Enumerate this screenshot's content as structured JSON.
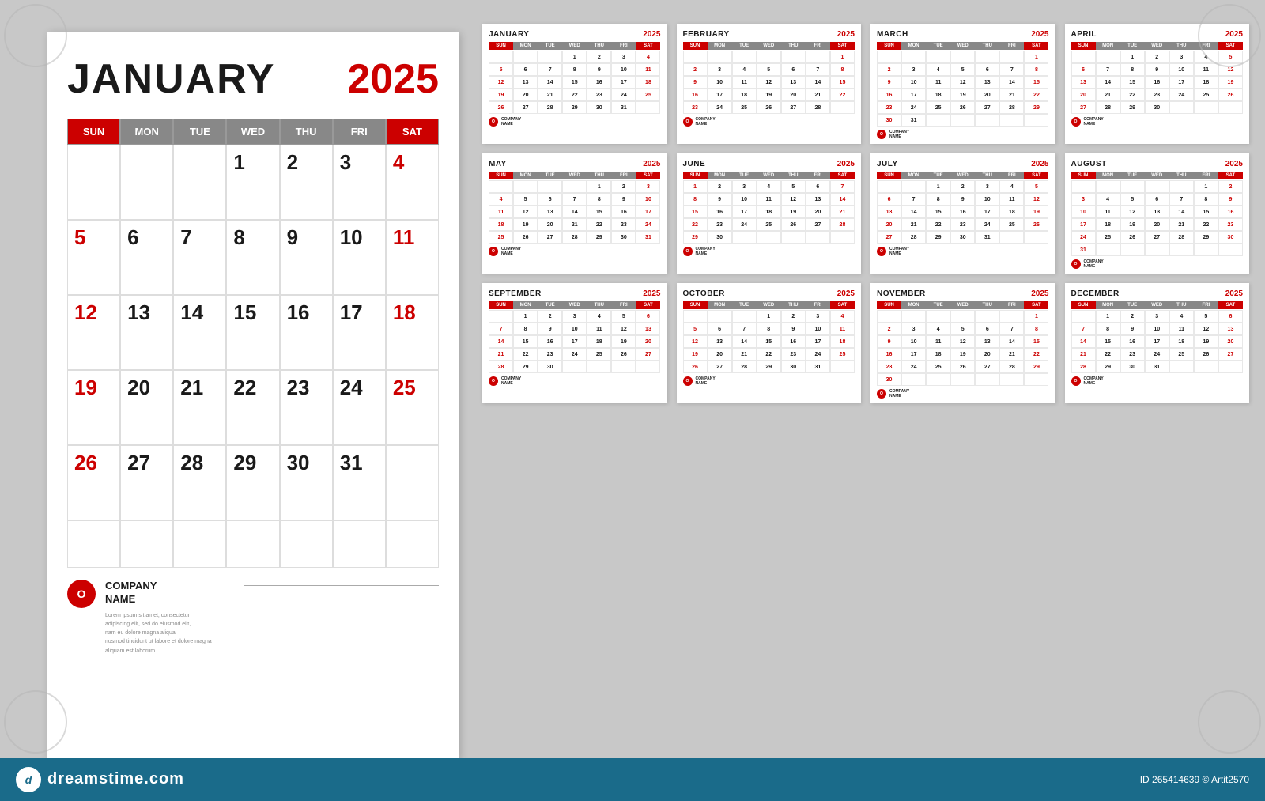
{
  "main": {
    "month": "JANUARY",
    "year": "2025",
    "days": [
      "SUN",
      "MON",
      "TUE",
      "WED",
      "THU",
      "FRI",
      "SAT"
    ],
    "company": {
      "name": "COMPANY\nNAME",
      "desc": "Lorem ipsum sit amet, consectetur\nadipiscing elit, sed do eiusmod elit,\n        nam eu dolore magna aliqua\nnusmod tincidunt ut labore et dolore magna\naliquam est laborum."
    },
    "rows": [
      [
        "",
        "",
        "",
        "1",
        "2",
        "3",
        "4"
      ],
      [
        "5",
        "6",
        "7",
        "8",
        "9",
        "10",
        "11"
      ],
      [
        "12",
        "13",
        "14",
        "15",
        "16",
        "17",
        "18"
      ],
      [
        "19",
        "20",
        "21",
        "22",
        "23",
        "24",
        "25"
      ],
      [
        "26",
        "27",
        "28",
        "29",
        "30",
        "31",
        ""
      ],
      [
        "",
        "",
        "",
        "",
        "",
        "",
        ""
      ]
    ],
    "red_cells": [
      "4",
      "11",
      "18",
      "25",
      "5",
      "12",
      "19",
      "26"
    ]
  },
  "small_calendars": [
    {
      "month": "JANUARY",
      "year": "2025",
      "rows": [
        [
          "",
          "",
          "",
          "1",
          "2",
          "3",
          "4"
        ],
        [
          "5",
          "6",
          "7",
          "8",
          "9",
          "10",
          "11"
        ],
        [
          "12",
          "13",
          "14",
          "15",
          "16",
          "17",
          "18"
        ],
        [
          "19",
          "20",
          "21",
          "22",
          "23",
          "24",
          "25"
        ],
        [
          "26",
          "27",
          "28",
          "29",
          "30",
          "31",
          ""
        ]
      ],
      "red": [
        "4",
        "11",
        "18",
        "25",
        "5",
        "12",
        "19",
        "26"
      ]
    },
    {
      "month": "FEBRUARY",
      "year": "2025",
      "rows": [
        [
          "",
          "",
          "",
          "",
          "",
          "",
          "1"
        ],
        [
          "2",
          "3",
          "4",
          "5",
          "6",
          "7",
          "8"
        ],
        [
          "9",
          "10",
          "11",
          "12",
          "13",
          "14",
          "15"
        ],
        [
          "16",
          "17",
          "18",
          "19",
          "20",
          "21",
          "22"
        ],
        [
          "23",
          "24",
          "25",
          "26",
          "27",
          "28",
          ""
        ]
      ],
      "red": [
        "1",
        "8",
        "15",
        "22",
        "2",
        "9",
        "16",
        "23"
      ]
    },
    {
      "month": "MARCH",
      "year": "2025",
      "rows": [
        [
          "",
          "",
          "",
          "",
          "",
          "",
          "1"
        ],
        [
          "2",
          "3",
          "4",
          "5",
          "6",
          "7",
          "8"
        ],
        [
          "9",
          "10",
          "11",
          "12",
          "13",
          "14",
          "15"
        ],
        [
          "16",
          "17",
          "18",
          "19",
          "20",
          "21",
          "22"
        ],
        [
          "23",
          "24",
          "25",
          "26",
          "27",
          "28",
          "29"
        ],
        [
          "30",
          "31",
          "",
          "",
          "",
          "",
          ""
        ]
      ],
      "red": [
        "1",
        "8",
        "15",
        "22",
        "29",
        "2",
        "9",
        "16",
        "23",
        "30"
      ]
    },
    {
      "month": "APRIL",
      "year": "2025",
      "rows": [
        [
          "",
          "",
          "1",
          "2",
          "3",
          "4",
          "5"
        ],
        [
          "6",
          "7",
          "8",
          "9",
          "10",
          "11",
          "12"
        ],
        [
          "13",
          "14",
          "15",
          "16",
          "17",
          "18",
          "19"
        ],
        [
          "20",
          "21",
          "22",
          "23",
          "24",
          "25",
          "26"
        ],
        [
          "27",
          "28",
          "29",
          "30",
          "",
          "",
          ""
        ]
      ],
      "red": [
        "5",
        "12",
        "19",
        "26",
        "6",
        "13",
        "20",
        "27"
      ]
    },
    {
      "month": "MAY",
      "year": "2025",
      "rows": [
        [
          "",
          "",
          "",
          "",
          "1",
          "2",
          "3"
        ],
        [
          "4",
          "5",
          "6",
          "7",
          "8",
          "9",
          "10"
        ],
        [
          "11",
          "12",
          "13",
          "14",
          "15",
          "16",
          "17"
        ],
        [
          "18",
          "19",
          "20",
          "21",
          "22",
          "23",
          "24"
        ],
        [
          "25",
          "26",
          "27",
          "28",
          "29",
          "30",
          "31"
        ]
      ],
      "red": [
        "3",
        "10",
        "17",
        "24",
        "31",
        "4",
        "11",
        "18",
        "25"
      ]
    },
    {
      "month": "JUNE",
      "year": "2025",
      "rows": [
        [
          "1",
          "2",
          "3",
          "4",
          "5",
          "6",
          "7"
        ],
        [
          "8",
          "9",
          "10",
          "11",
          "12",
          "13",
          "14"
        ],
        [
          "15",
          "16",
          "17",
          "18",
          "19",
          "20",
          "21"
        ],
        [
          "22",
          "23",
          "24",
          "25",
          "26",
          "27",
          "28"
        ],
        [
          "29",
          "30",
          "",
          "",
          "",
          "",
          ""
        ]
      ],
      "red": [
        "1",
        "7",
        "8",
        "14",
        "15",
        "21",
        "22",
        "28",
        "29"
      ]
    },
    {
      "month": "JULY",
      "year": "2025",
      "rows": [
        [
          "",
          "",
          "1",
          "2",
          "3",
          "4",
          "5"
        ],
        [
          "6",
          "7",
          "8",
          "9",
          "10",
          "11",
          "12"
        ],
        [
          "13",
          "14",
          "15",
          "16",
          "17",
          "18",
          "19"
        ],
        [
          "20",
          "21",
          "22",
          "23",
          "24",
          "25",
          "26"
        ],
        [
          "27",
          "28",
          "29",
          "30",
          "31",
          "",
          ""
        ]
      ],
      "red": [
        "5",
        "12",
        "19",
        "26",
        "6",
        "13",
        "20",
        "27"
      ]
    },
    {
      "month": "AUGUST",
      "year": "2025",
      "rows": [
        [
          "",
          "",
          "",
          "",
          "",
          "1",
          "2"
        ],
        [
          "3",
          "4",
          "5",
          "6",
          "7",
          "8",
          "9"
        ],
        [
          "10",
          "11",
          "12",
          "13",
          "14",
          "15",
          "16"
        ],
        [
          "17",
          "18",
          "19",
          "20",
          "21",
          "22",
          "23"
        ],
        [
          "24",
          "25",
          "26",
          "27",
          "28",
          "29",
          "30"
        ],
        [
          "31",
          "",
          "",
          "",
          "",
          "",
          ""
        ]
      ],
      "red": [
        "2",
        "9",
        "16",
        "23",
        "30",
        "3",
        "10",
        "17",
        "24",
        "31"
      ]
    },
    {
      "month": "SEPTEMBER",
      "year": "2025",
      "rows": [
        [
          "",
          "1",
          "2",
          "3",
          "4",
          "5",
          "6"
        ],
        [
          "7",
          "8",
          "9",
          "10",
          "11",
          "12",
          "13"
        ],
        [
          "14",
          "15",
          "16",
          "17",
          "18",
          "19",
          "20"
        ],
        [
          "21",
          "22",
          "23",
          "24",
          "25",
          "26",
          "27"
        ],
        [
          "28",
          "29",
          "30",
          "",
          "",
          "",
          ""
        ]
      ],
      "red": [
        "6",
        "13",
        "20",
        "27",
        "7",
        "14",
        "21",
        "28"
      ]
    },
    {
      "month": "OCTOBER",
      "year": "2025",
      "rows": [
        [
          "",
          "",
          "",
          "1",
          "2",
          "3",
          "4"
        ],
        [
          "5",
          "6",
          "7",
          "8",
          "9",
          "10",
          "11"
        ],
        [
          "12",
          "13",
          "14",
          "15",
          "16",
          "17",
          "18"
        ],
        [
          "19",
          "20",
          "21",
          "22",
          "23",
          "24",
          "25"
        ],
        [
          "26",
          "27",
          "28",
          "29",
          "30",
          "31",
          ""
        ]
      ],
      "red": [
        "4",
        "11",
        "18",
        "25",
        "5",
        "12",
        "19",
        "26"
      ]
    },
    {
      "month": "NOVEMBER",
      "year": "2025",
      "rows": [
        [
          "",
          "",
          "",
          "",
          "",
          "",
          "1"
        ],
        [
          "2",
          "3",
          "4",
          "5",
          "6",
          "7",
          "8"
        ],
        [
          "9",
          "10",
          "11",
          "12",
          "13",
          "14",
          "15"
        ],
        [
          "16",
          "17",
          "18",
          "19",
          "20",
          "21",
          "22"
        ],
        [
          "23",
          "24",
          "25",
          "26",
          "27",
          "28",
          "29"
        ],
        [
          "30",
          "",
          "",
          "",
          "",
          "",
          ""
        ]
      ],
      "red": [
        "1",
        "8",
        "15",
        "22",
        "29",
        "2",
        "9",
        "16",
        "23",
        "30"
      ]
    },
    {
      "month": "DECEMBER",
      "year": "2025",
      "rows": [
        [
          "",
          "1",
          "2",
          "3",
          "4",
          "5",
          "6"
        ],
        [
          "7",
          "8",
          "9",
          "10",
          "11",
          "12",
          "13"
        ],
        [
          "14",
          "15",
          "16",
          "17",
          "18",
          "19",
          "20"
        ],
        [
          "21",
          "22",
          "23",
          "24",
          "25",
          "26",
          "27"
        ],
        [
          "28",
          "29",
          "30",
          "31",
          "",
          "",
          ""
        ]
      ],
      "red": [
        "6",
        "13",
        "20",
        "27",
        "7",
        "14",
        "21",
        "28"
      ]
    }
  ],
  "dreamstime": {
    "logo_letter": "d",
    "site": "dreamstime.com",
    "id": "265414639",
    "artist": "Artit2570"
  }
}
